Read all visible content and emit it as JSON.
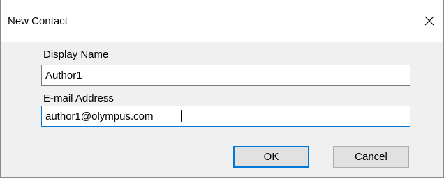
{
  "dialog": {
    "title": "New Contact",
    "close_icon": "close-icon"
  },
  "form": {
    "display_name_label": "Display Name",
    "display_name_value": "Author1",
    "email_label": "E-mail Address",
    "email_value": "author1@olympus.com"
  },
  "buttons": {
    "ok_label": "OK",
    "cancel_label": "Cancel"
  },
  "colors": {
    "focus_border": "#0078d7",
    "client_background": "#f0f0f0"
  }
}
